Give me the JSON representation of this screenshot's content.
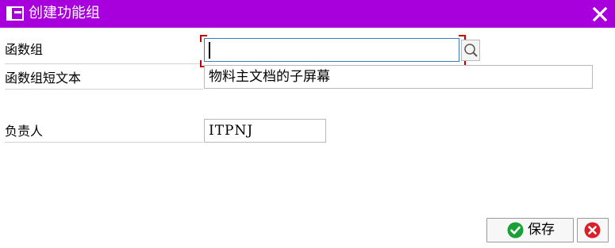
{
  "window": {
    "title": "创建功能组",
    "title_bar_color": "#a800dc"
  },
  "form": {
    "function_group": {
      "label": "函数组",
      "value": ""
    },
    "short_text": {
      "label": "函数组短文本",
      "value": "物料主文档的子屏幕"
    },
    "responsible": {
      "label": "负责人",
      "value": "ITPNJ"
    }
  },
  "buttons": {
    "save_label": "保存",
    "cancel_icon": "cancel-icon",
    "confirm_icon": "check-icon"
  },
  "colors": {
    "accent": "#a800dc",
    "focus_corner": "#c00000",
    "confirm": "#1aa037",
    "cancel": "#d9202a"
  }
}
